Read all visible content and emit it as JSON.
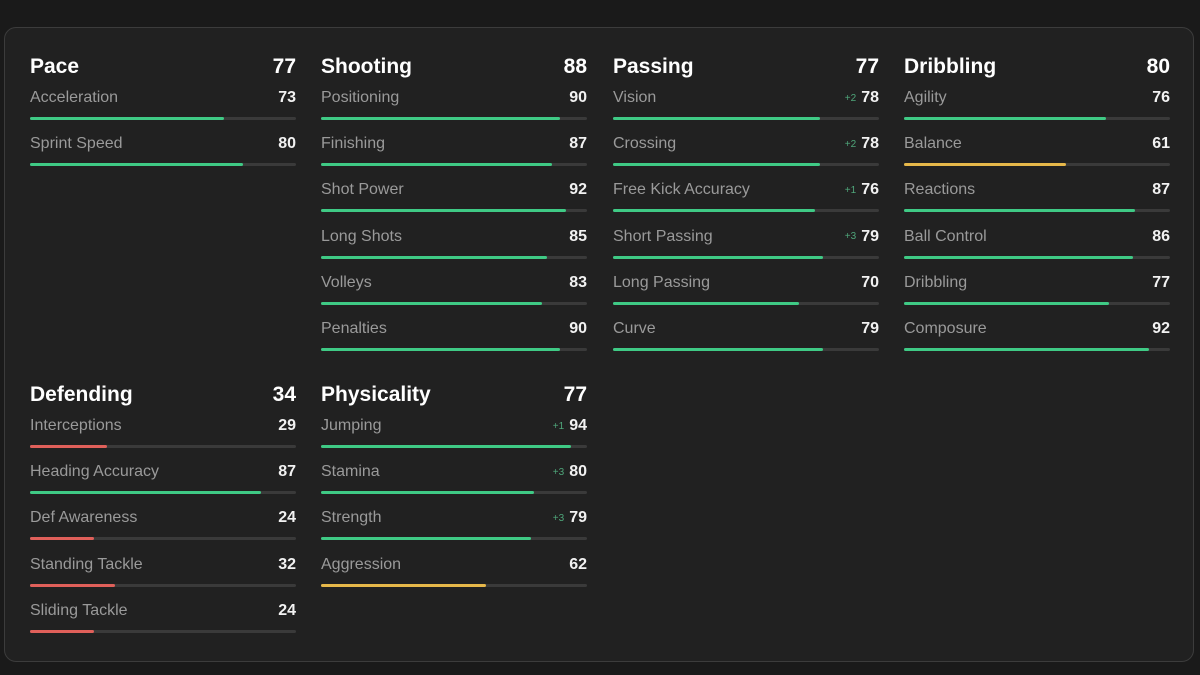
{
  "colors": {
    "high": "#3fca85",
    "mid": "#e6b84a",
    "low": "#e0605a"
  },
  "groups": [
    {
      "title": "Pace",
      "value": 77,
      "stats": [
        {
          "name": "Acceleration",
          "value": 73,
          "delta": ""
        },
        {
          "name": "Sprint Speed",
          "value": 80,
          "delta": ""
        }
      ]
    },
    {
      "title": "Shooting",
      "value": 88,
      "stats": [
        {
          "name": "Positioning",
          "value": 90,
          "delta": ""
        },
        {
          "name": "Finishing",
          "value": 87,
          "delta": ""
        },
        {
          "name": "Shot Power",
          "value": 92,
          "delta": ""
        },
        {
          "name": "Long Shots",
          "value": 85,
          "delta": ""
        },
        {
          "name": "Volleys",
          "value": 83,
          "delta": ""
        },
        {
          "name": "Penalties",
          "value": 90,
          "delta": ""
        }
      ]
    },
    {
      "title": "Passing",
      "value": 77,
      "stats": [
        {
          "name": "Vision",
          "value": 78,
          "delta": "+2"
        },
        {
          "name": "Crossing",
          "value": 78,
          "delta": "+2"
        },
        {
          "name": "Free Kick Accuracy",
          "value": 76,
          "delta": "+1"
        },
        {
          "name": "Short Passing",
          "value": 79,
          "delta": "+3"
        },
        {
          "name": "Long Passing",
          "value": 70,
          "delta": ""
        },
        {
          "name": "Curve",
          "value": 79,
          "delta": ""
        }
      ]
    },
    {
      "title": "Dribbling",
      "value": 80,
      "stats": [
        {
          "name": "Agility",
          "value": 76,
          "delta": ""
        },
        {
          "name": "Balance",
          "value": 61,
          "delta": ""
        },
        {
          "name": "Reactions",
          "value": 87,
          "delta": ""
        },
        {
          "name": "Ball Control",
          "value": 86,
          "delta": ""
        },
        {
          "name": "Dribbling",
          "value": 77,
          "delta": ""
        },
        {
          "name": "Composure",
          "value": 92,
          "delta": ""
        }
      ]
    },
    {
      "title": "Defending",
      "value": 34,
      "stats": [
        {
          "name": "Interceptions",
          "value": 29,
          "delta": ""
        },
        {
          "name": "Heading Accuracy",
          "value": 87,
          "delta": ""
        },
        {
          "name": "Def Awareness",
          "value": 24,
          "delta": ""
        },
        {
          "name": "Standing Tackle",
          "value": 32,
          "delta": ""
        },
        {
          "name": "Sliding Tackle",
          "value": 24,
          "delta": ""
        }
      ]
    },
    {
      "title": "Physicality",
      "value": 77,
      "stats": [
        {
          "name": "Jumping",
          "value": 94,
          "delta": "+1"
        },
        {
          "name": "Stamina",
          "value": 80,
          "delta": "+3"
        },
        {
          "name": "Strength",
          "value": 79,
          "delta": "+3"
        },
        {
          "name": "Aggression",
          "value": 62,
          "delta": ""
        }
      ]
    }
  ]
}
